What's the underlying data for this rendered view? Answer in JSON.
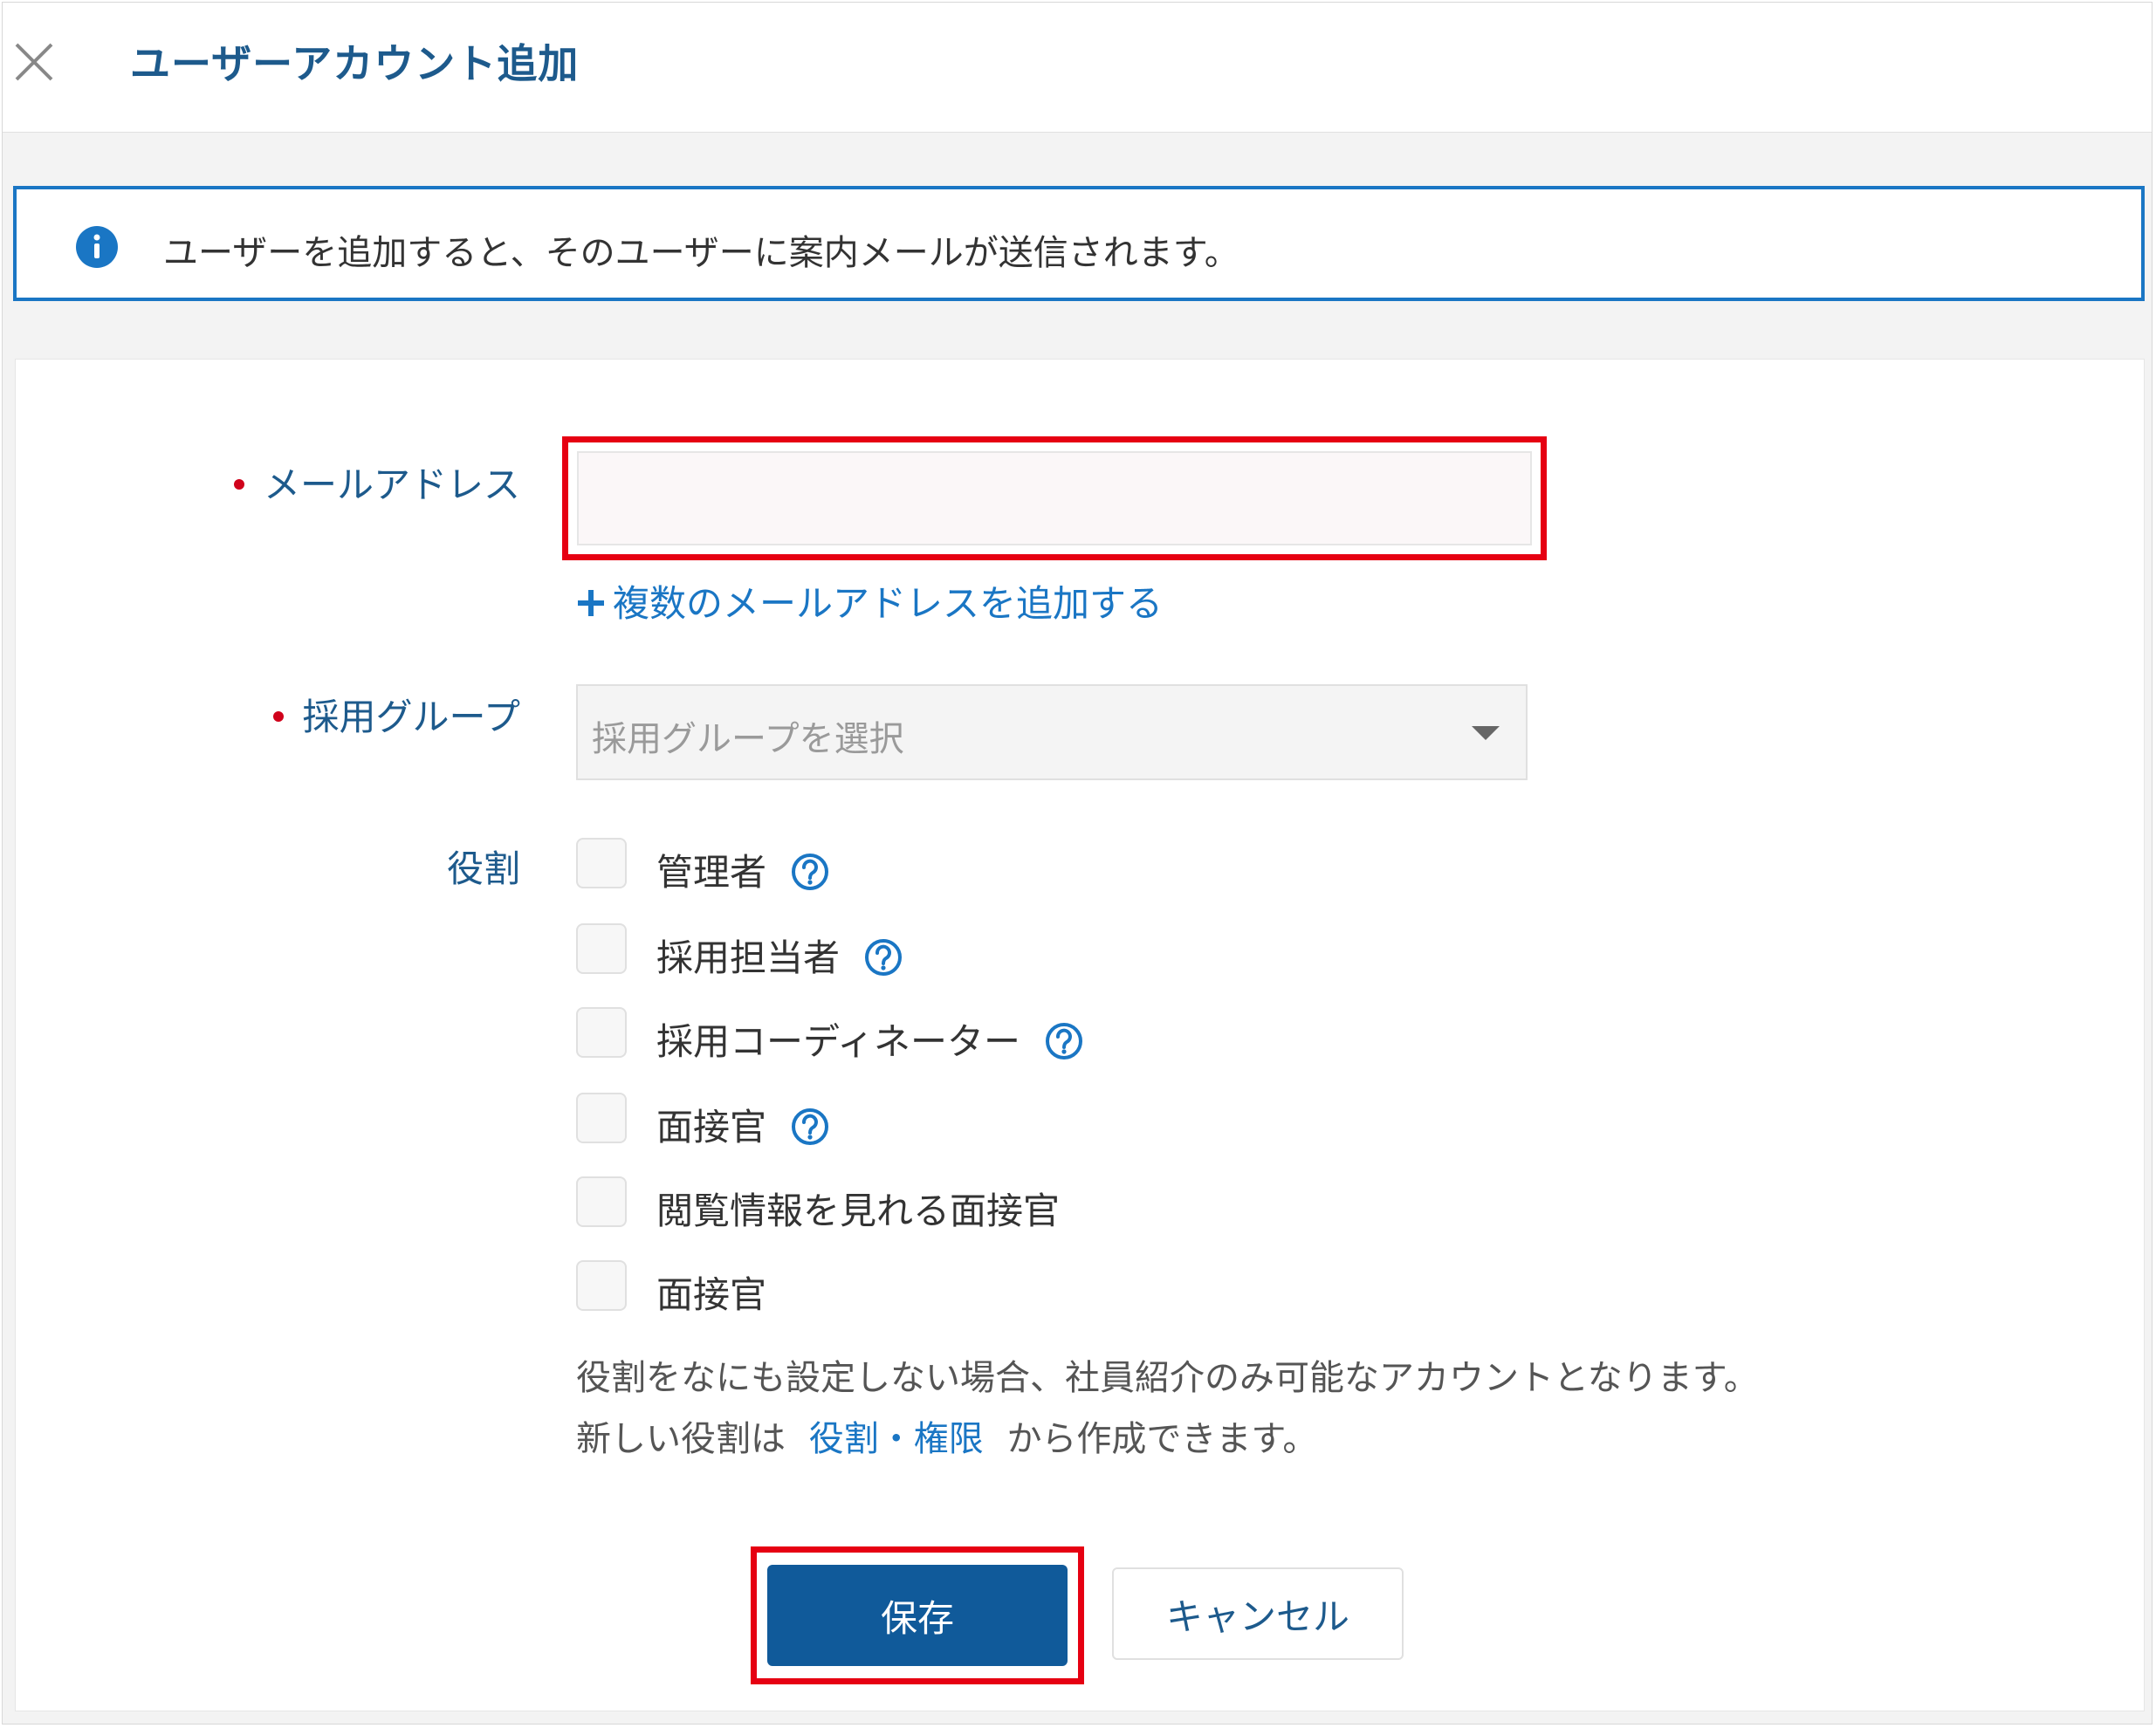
{
  "header": {
    "title": "ユーザーアカウント追加",
    "close_icon": "close-icon"
  },
  "notice": {
    "icon": "info-icon",
    "text": "ユーザーを追加すると、そのユーザーに案内メールが送信されます。"
  },
  "form": {
    "email": {
      "label": "メールアドレス",
      "required": true,
      "value": "",
      "add_multiple_icon": "plus-icon",
      "add_multiple_label": "複数のメールアドレスを追加する"
    },
    "group": {
      "label": "採用グループ",
      "required": true,
      "placeholder": "採用グループを選択",
      "caret_icon": "caret-down-icon"
    },
    "roles": {
      "label": "役割",
      "items": [
        {
          "label": "管理者",
          "checked": false,
          "help": true
        },
        {
          "label": "採用担当者",
          "checked": false,
          "help": true
        },
        {
          "label": "採用コーディネーター",
          "checked": false,
          "help": true
        },
        {
          "label": "面接官",
          "checked": false,
          "help": true
        },
        {
          "label": "閲覧情報を見れる面接官",
          "checked": false,
          "help": false
        },
        {
          "label": "面接官",
          "checked": false,
          "help": false
        }
      ],
      "help_line1": "役割をなにも設定しない場合、社員紹介のみ可能なアカウントとなります。",
      "help_line2_prefix": "新しい役割は",
      "help_line2_link": "役割・権限",
      "help_line2_suffix": "から作成できます。"
    }
  },
  "actions": {
    "save_label": "保存",
    "cancel_label": "キャンセル"
  },
  "colors": {
    "accent": "#1a76c4",
    "heading": "#1d5a8c",
    "primary_button": "#105a9a",
    "required": "#d0021b",
    "highlight": "#e60012"
  }
}
